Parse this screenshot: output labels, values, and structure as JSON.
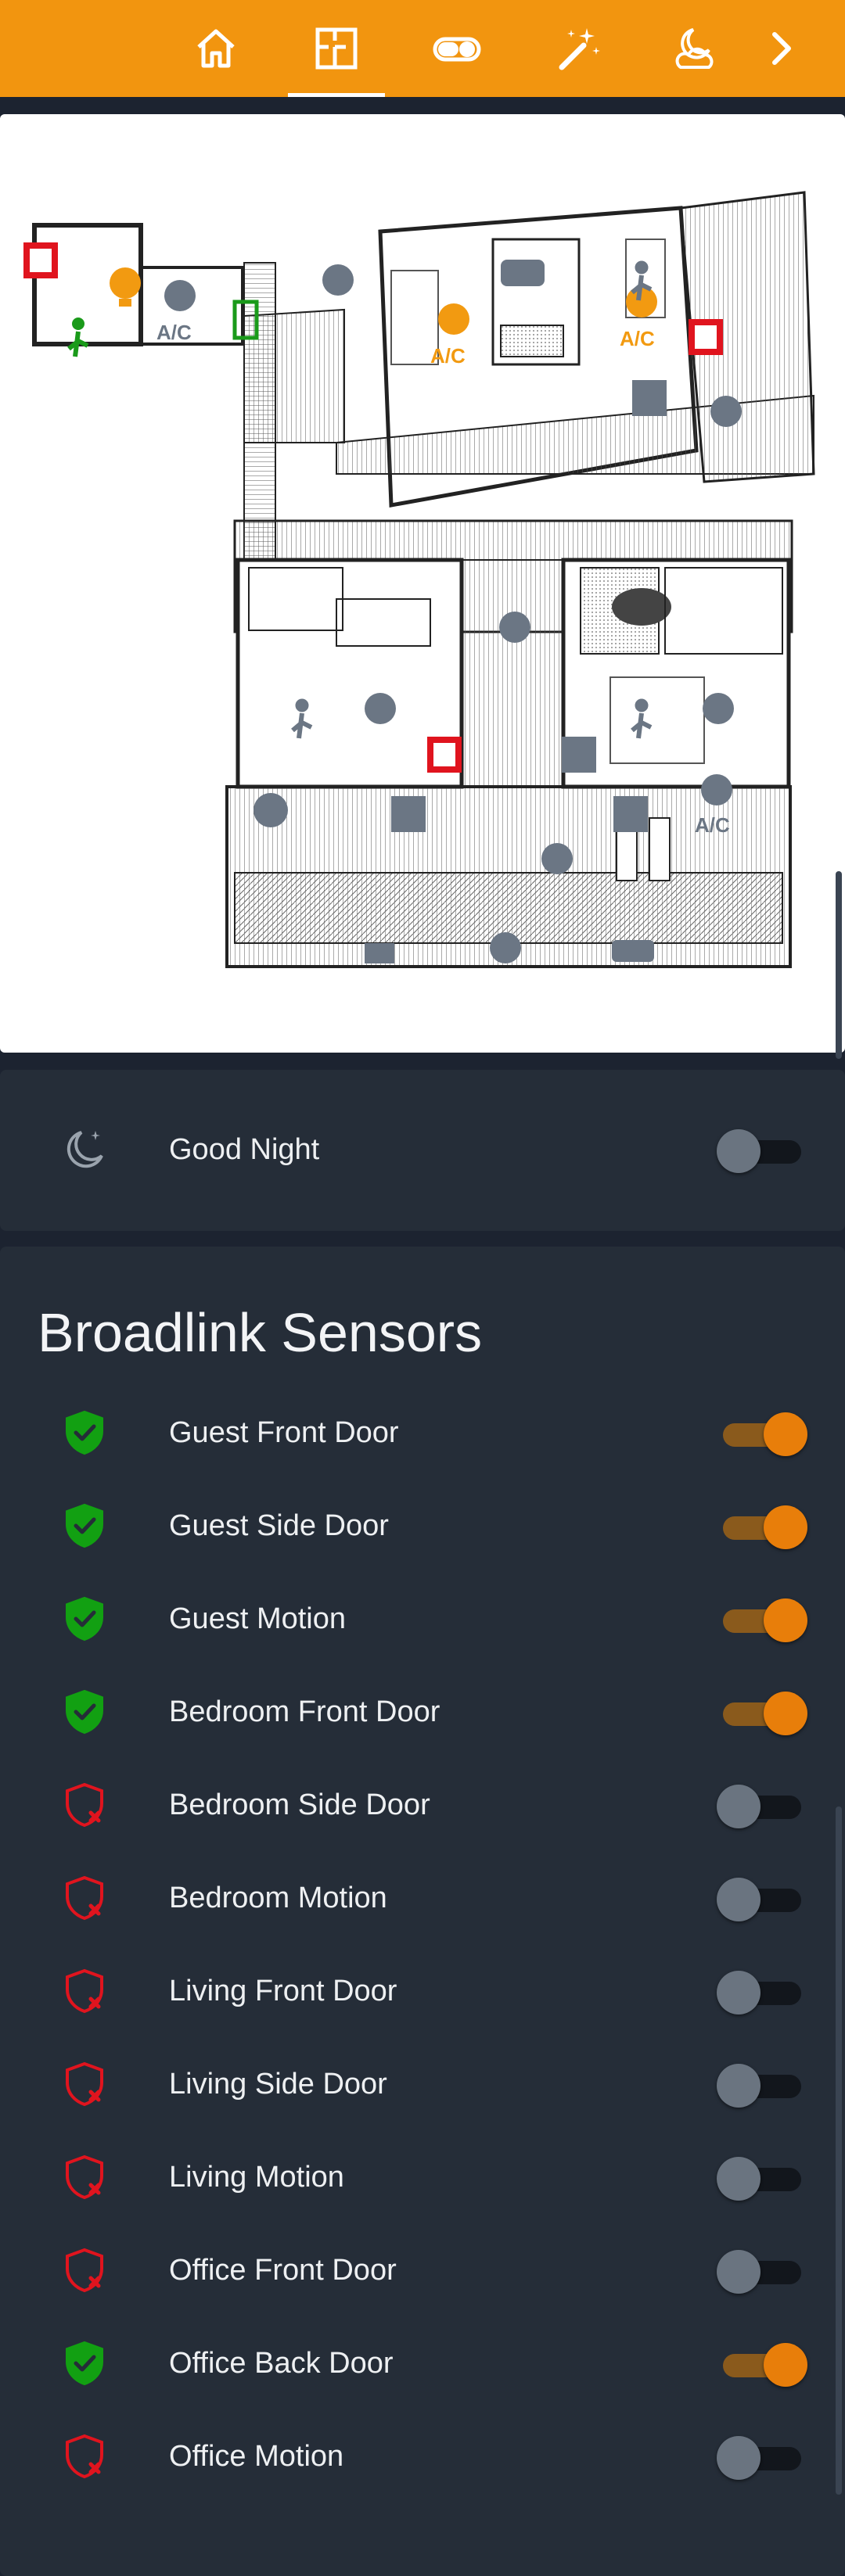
{
  "nav": {
    "tabs": [
      {
        "icon": "home-icon"
      },
      {
        "icon": "floorplan-icon",
        "active": true
      },
      {
        "icon": "toggle-icon"
      },
      {
        "icon": "magic-wand-icon"
      },
      {
        "icon": "weather-night-icon"
      },
      {
        "icon": "chevron-right-icon"
      }
    ]
  },
  "floorplan": {
    "ac_label": "A/C"
  },
  "scene": {
    "label": "Good Night",
    "icon": "moon-stars-icon",
    "on": false
  },
  "sensors": {
    "title": "Broadlink Sensors",
    "colors": {
      "armed": "#12a012",
      "disarmed": "#e0141e",
      "on": "#e87e0a"
    },
    "items": [
      {
        "label": "Guest Front Door",
        "armed": true
      },
      {
        "label": "Guest Side Door",
        "armed": true
      },
      {
        "label": "Guest Motion",
        "armed": true
      },
      {
        "label": "Bedroom Front Door",
        "armed": true
      },
      {
        "label": "Bedroom Side Door",
        "armed": false
      },
      {
        "label": "Bedroom Motion",
        "armed": false
      },
      {
        "label": "Living Front Door",
        "armed": false
      },
      {
        "label": "Living Side Door",
        "armed": false
      },
      {
        "label": "Living Motion",
        "armed": false
      },
      {
        "label": "Office Front Door",
        "armed": false
      },
      {
        "label": "Office Back Door",
        "armed": true
      },
      {
        "label": "Office Motion",
        "armed": false
      }
    ]
  }
}
